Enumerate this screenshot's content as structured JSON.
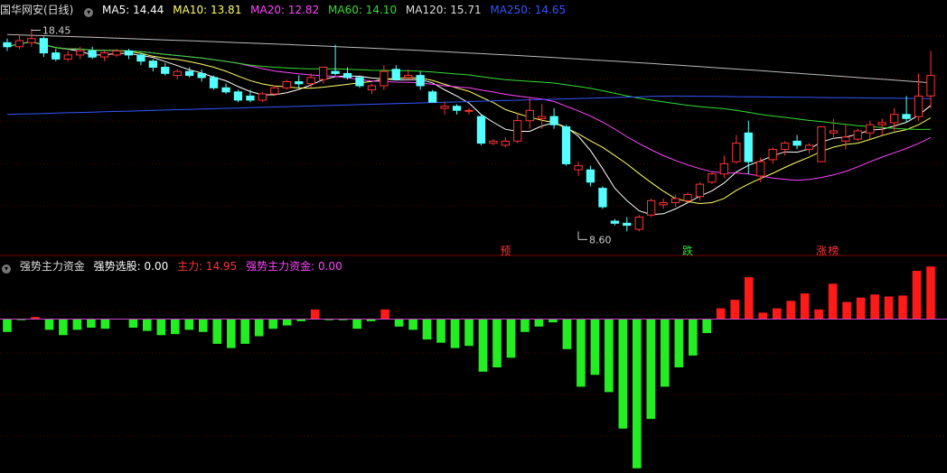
{
  "header_top": {
    "stock_name": "国华网安(日线)",
    "ma": [
      {
        "label": "MA5: 14.44",
        "color": "#ffffff"
      },
      {
        "label": "MA10: 13.81",
        "color": "#ffff66"
      },
      {
        "label": "MA20: 12.82",
        "color": "#ff44ff"
      },
      {
        "label": "MA60: 14.10",
        "color": "#33dd33"
      },
      {
        "label": "MA120: 15.71",
        "color": "#dddddd"
      },
      {
        "label": "MA250: 14.65",
        "color": "#3355ff"
      }
    ]
  },
  "header_bottom": {
    "indicator_name": "强势主力资金",
    "items": [
      {
        "label": "强势选股: 0.00",
        "color": "#ffffff"
      },
      {
        "label": "主力: 14.95",
        "color": "#ff3333"
      },
      {
        "label": "强势主力资金: 0.00",
        "color": "#ff44ff"
      }
    ]
  },
  "icons": {
    "toggle": "chevron-down-icon"
  },
  "chart_data": [
    {
      "type": "candlestick",
      "title": "国华网安(日线)",
      "ylim": [
        8,
        19
      ],
      "up_color": "#ff3333",
      "down_color": "#55ffff",
      "annotations": [
        {
          "text": "18.45",
          "index": 2,
          "value": 18.45
        },
        {
          "text": "8.60",
          "index": 47,
          "value": 8.6
        }
      ],
      "markers": [
        {
          "text": "预",
          "index": 41,
          "color": "#ff3333"
        },
        {
          "text": "跌",
          "index": 56,
          "color": "#33dd33"
        },
        {
          "text": "涨",
          "index": 67,
          "color": "#ff3333"
        },
        {
          "text": "榜",
          "index": 68,
          "color": "#ff3333"
        }
      ],
      "ohlc": [
        [
          17.8,
          18.0,
          17.4,
          17.6
        ],
        [
          17.6,
          18.2,
          17.5,
          17.9
        ],
        [
          17.8,
          18.45,
          17.6,
          18.0
        ],
        [
          18.0,
          18.1,
          17.1,
          17.3
        ],
        [
          17.3,
          17.5,
          16.9,
          17.0
        ],
        [
          17.0,
          17.4,
          16.9,
          17.2
        ],
        [
          17.2,
          17.6,
          17.0,
          17.4
        ],
        [
          17.4,
          17.6,
          17.0,
          17.1
        ],
        [
          17.1,
          17.4,
          16.9,
          17.3
        ],
        [
          17.2,
          17.5,
          17.1,
          17.4
        ],
        [
          17.4,
          17.5,
          17.0,
          17.2
        ],
        [
          17.2,
          17.3,
          16.7,
          16.9
        ],
        [
          16.9,
          17.0,
          16.4,
          16.6
        ],
        [
          16.6,
          16.8,
          16.2,
          16.3
        ],
        [
          16.2,
          16.5,
          16.0,
          16.4
        ],
        [
          16.4,
          16.6,
          16.1,
          16.2
        ],
        [
          16.3,
          16.5,
          15.9,
          16.1
        ],
        [
          16.1,
          16.2,
          15.5,
          15.6
        ],
        [
          15.6,
          15.8,
          15.3,
          15.4
        ],
        [
          15.4,
          15.5,
          14.9,
          15.0
        ],
        [
          15.2,
          15.5,
          14.9,
          15.0
        ],
        [
          15.0,
          15.4,
          14.9,
          15.3
        ],
        [
          15.3,
          15.7,
          15.2,
          15.6
        ],
        [
          15.6,
          16.0,
          15.5,
          15.9
        ],
        [
          15.9,
          16.2,
          15.6,
          15.8
        ],
        [
          15.8,
          16.3,
          15.6,
          16.1
        ],
        [
          16.0,
          16.6,
          15.8,
          16.6
        ],
        [
          16.4,
          17.7,
          16.2,
          16.3
        ],
        [
          16.3,
          16.6,
          16.0,
          16.1
        ],
        [
          16.1,
          16.2,
          15.6,
          15.7
        ],
        [
          15.5,
          15.8,
          15.3,
          15.7
        ],
        [
          15.7,
          16.7,
          15.5,
          16.4
        ],
        [
          16.5,
          16.7,
          16.1,
          16.0
        ],
        [
          16.1,
          16.5,
          16.0,
          16.2
        ],
        [
          16.2,
          16.4,
          15.5,
          15.7
        ],
        [
          15.4,
          15.5,
          14.9,
          14.9
        ],
        [
          14.6,
          14.9,
          14.3,
          14.7
        ],
        [
          14.7,
          14.8,
          14.3,
          14.5
        ],
        [
          14.5,
          14.6,
          14.3,
          14.5
        ],
        [
          14.2,
          14.3,
          12.8,
          12.9
        ],
        [
          12.9,
          13.1,
          12.8,
          13.0
        ],
        [
          12.8,
          13.2,
          12.7,
          13.0
        ],
        [
          13.0,
          14.4,
          12.9,
          14.0
        ],
        [
          14.0,
          15.1,
          13.6,
          14.5
        ],
        [
          14.1,
          14.8,
          13.6,
          14.2
        ],
        [
          14.2,
          14.6,
          13.6,
          13.8
        ],
        [
          13.7,
          13.8,
          11.8,
          11.9
        ],
        [
          11.6,
          12.0,
          11.3,
          11.8
        ],
        [
          11.6,
          11.8,
          10.8,
          11.0
        ],
        [
          10.7,
          10.8,
          9.7,
          9.8
        ],
        [
          9.1,
          9.2,
          8.9,
          9.0
        ],
        [
          9.0,
          9.3,
          8.6,
          8.9
        ],
        [
          8.7,
          9.4,
          8.6,
          9.3
        ],
        [
          9.4,
          10.2,
          9.3,
          10.1
        ],
        [
          9.9,
          10.2,
          9.7,
          10.0
        ],
        [
          10.0,
          10.4,
          9.8,
          10.2
        ],
        [
          10.1,
          10.5,
          10.0,
          10.4
        ],
        [
          10.3,
          11.0,
          10.1,
          10.9
        ],
        [
          11.0,
          11.5,
          10.9,
          11.4
        ],
        [
          11.4,
          12.3,
          11.2,
          11.9
        ],
        [
          12.0,
          13.3,
          11.9,
          12.9
        ],
        [
          13.4,
          14.0,
          11.4,
          12.0
        ],
        [
          11.3,
          12.2,
          11.0,
          12.0
        ],
        [
          12.1,
          12.7,
          11.9,
          12.6
        ],
        [
          12.6,
          13.0,
          12.3,
          12.9
        ],
        [
          13.0,
          13.3,
          12.6,
          12.8
        ],
        [
          12.6,
          12.9,
          12.4,
          12.8
        ],
        [
          12.0,
          13.7,
          12.0,
          13.7
        ],
        [
          13.4,
          14.1,
          13.1,
          13.5
        ],
        [
          13.0,
          13.8,
          12.6,
          13.2
        ],
        [
          13.1,
          13.6,
          13.0,
          13.5
        ],
        [
          13.4,
          14.0,
          13.1,
          13.8
        ],
        [
          13.8,
          14.1,
          13.3,
          13.9
        ],
        [
          13.9,
          14.6,
          13.5,
          14.3
        ],
        [
          14.3,
          15.2,
          13.9,
          14.1
        ],
        [
          14.2,
          16.3,
          14.0,
          15.2
        ],
        [
          15.2,
          17.4,
          14.6,
          16.2
        ]
      ]
    },
    {
      "type": "bar",
      "title": "强势主力资金",
      "ylim": [
        -14,
        4.5
      ],
      "values": [
        -1.2,
        -0.1,
        0.2,
        -1.0,
        -1.5,
        -1.0,
        -0.8,
        -0.9,
        0,
        -0.8,
        -1.1,
        -1.5,
        -1.4,
        -1.0,
        -1.2,
        -2.3,
        -2.7,
        -2.3,
        -1.6,
        -0.9,
        -0.6,
        -0.2,
        0.9,
        -0.1,
        -0.1,
        -0.9,
        -0.2,
        0.9,
        -0.7,
        -1.0,
        -1.9,
        -2.2,
        -2.7,
        -2.5,
        -4.9,
        -4.5,
        -3.6,
        -1.2,
        -0.7,
        -0.3,
        -2.8,
        -6.3,
        -5.2,
        -6.8,
        -10.2,
        -13.9,
        -9.3,
        -6.3,
        -4.5,
        -3.4,
        -1.3,
        1.0,
        1.8,
        3.9,
        0.6,
        1.0,
        1.7,
        2.4,
        0.9,
        3.3,
        1.6,
        2.0,
        2.3,
        2.1,
        2.2,
        4.5,
        4.9
      ]
    }
  ]
}
